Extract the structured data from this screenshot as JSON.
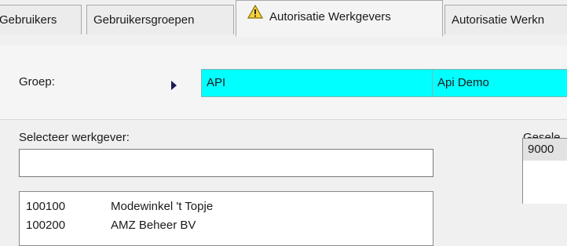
{
  "tabs": [
    {
      "label": "Gebruikers",
      "active": false
    },
    {
      "label": "Gebruikersgroepen",
      "active": false
    },
    {
      "label": "Autorisatie Werkgevers",
      "active": true,
      "icon": "warning-icon"
    },
    {
      "label": "Autorisatie Werkn",
      "active": false
    }
  ],
  "groep": {
    "label": "Groep:",
    "code": "API",
    "name": "Api Demo",
    "field_color": "#00ffff"
  },
  "select_employer": {
    "label": "Selecteer werkgever:",
    "search_value": "",
    "items": [
      {
        "code": "100100",
        "name": "Modewinkel 't Topje"
      },
      {
        "code": "100200",
        "name": "AMZ Beheer BV"
      }
    ]
  },
  "selected": {
    "label": "Gesele",
    "items": [
      {
        "code": "9000"
      }
    ]
  }
}
